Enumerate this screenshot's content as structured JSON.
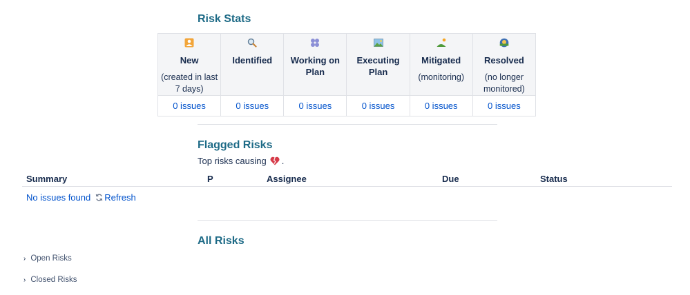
{
  "risk_stats": {
    "title": "Risk Stats",
    "columns": [
      {
        "icon": "person-card-icon",
        "label": "New",
        "sub": "(created in last 7 days)",
        "count": "0 issues"
      },
      {
        "icon": "magnifier-icon",
        "label": "Identified",
        "sub": "",
        "count": "0 issues"
      },
      {
        "icon": "four-circles-icon",
        "label": "Working on Plan",
        "sub": "",
        "count": "0 issues"
      },
      {
        "icon": "landscape-picture-icon",
        "label": "Executing Plan",
        "sub": "",
        "count": "0 issues"
      },
      {
        "icon": "sunrise-hill-icon",
        "label": "Mitigated",
        "sub": "(monitoring)",
        "count": "0 issues"
      },
      {
        "icon": "sunset-dome-icon",
        "label": "Resolved",
        "sub": "(no longer monitored)",
        "count": "0 issues"
      }
    ]
  },
  "flagged": {
    "title": "Flagged Risks",
    "intro": "Top risks causing",
    "intro_end": ".",
    "emoji_icon": "broken-heart-icon",
    "columns": {
      "summary": "Summary",
      "p": "P",
      "assignee": "Assignee",
      "due": "Due",
      "status": "Status"
    },
    "empty": "No issues found",
    "refresh": "Refresh"
  },
  "all_risks": {
    "title": "All Risks",
    "open": "Open Risks",
    "closed": "Closed Risks"
  },
  "colors": {
    "heading": "#1d6a86",
    "link": "#0052cc",
    "border": "#dfe1e6",
    "header_bg": "#f4f5f7",
    "text": "#172b4d"
  }
}
